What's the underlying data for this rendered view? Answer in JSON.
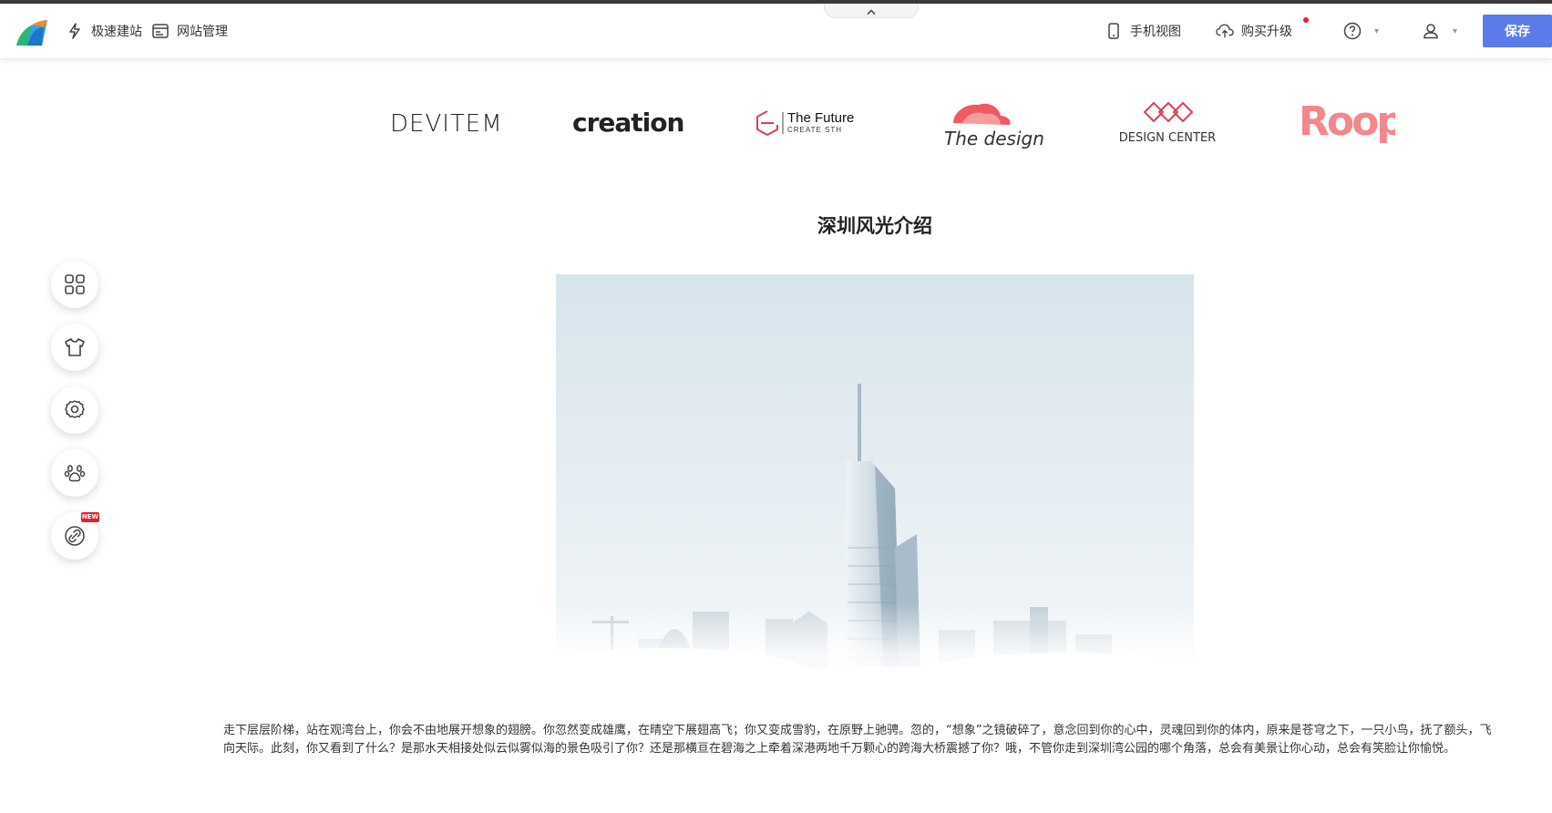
{
  "toolbar": {
    "quick_build": "极速建站",
    "site_manage": "网站管理",
    "mobile_view": "手机视图",
    "buy_upgrade": "购买升级",
    "save": "保存",
    "icons": {
      "collapse": "chevron-up-icon",
      "quick_build": "lightning-icon",
      "site_manage": "browser-window-icon",
      "mobile_view": "phone-icon",
      "buy_upgrade": "cloud-upload-icon",
      "help": "help-circle-icon",
      "user": "user-icon"
    },
    "accent_color": "#5b7ce8",
    "notice_color": "#e5202e"
  },
  "brand_logos": {
    "devitems": "DEVITEMS",
    "creation": "creation",
    "future_title": "The Future",
    "future_sub": "CREATE STH",
    "design": "The design",
    "design_center": "DESIGN CENTER",
    "roop": "Roop"
  },
  "section": {
    "title": "深圳风光介绍",
    "description": "走下层层阶梯，站在观湾台上，你会不由地展开想象的翅膀。你忽然变成雄鹰，在晴空下展翅高飞；你又变成雪豹，在原野上驰骋。忽的，“想象”之镜破碎了，意念回到你的心中，灵魂回到你的体内，原来是苍穹之下，一只小鸟，抚了额头，飞向天际。此刻，你又看到了什么？是那水天相接处似云似雾似海的景色吸引了你？还是那横亘在碧海之上牵着深港两地千万颗心的跨海大桥震撼了你？哦，不管你走到深圳湾公园的哪个角落，总会有美景让你心动，总会有笑脸让你愉悦。"
  },
  "sidebar": {
    "badge": "NEW",
    "items": [
      "grid-icon",
      "tshirt-icon",
      "gear-icon",
      "paw-icon",
      "link-icon"
    ]
  }
}
